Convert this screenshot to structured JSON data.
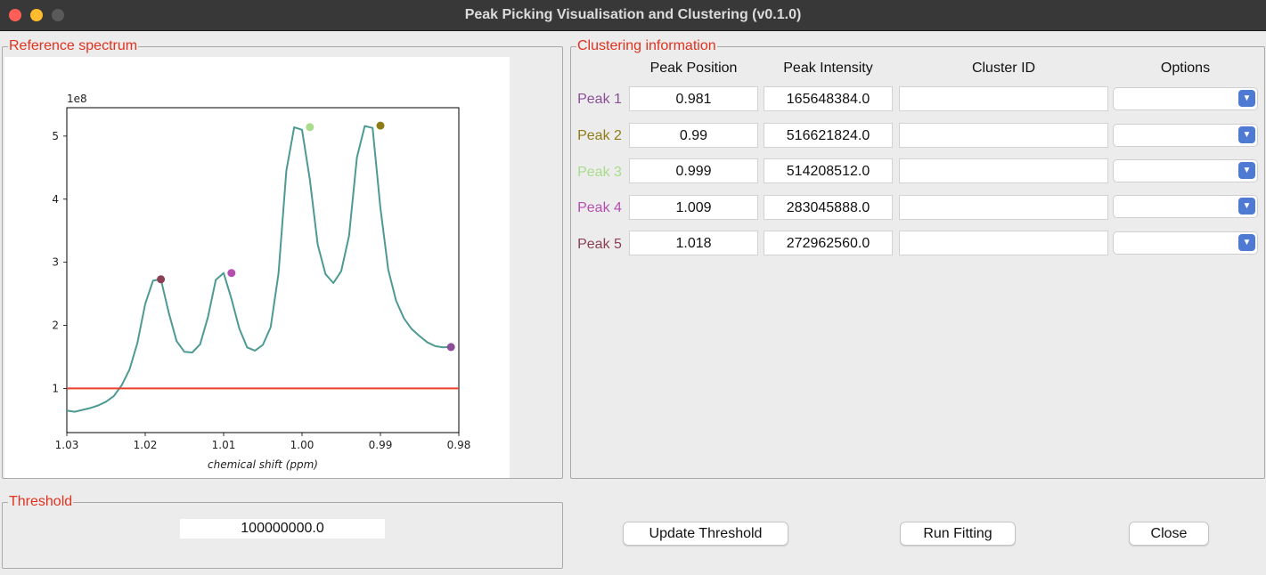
{
  "window": {
    "title": "Peak Picking Visualisation and Clustering (v0.1.0)"
  },
  "reference_panel": {
    "title": "Reference spectrum"
  },
  "clustering_panel": {
    "title": "Clustering information",
    "headers": {
      "position": "Peak Position",
      "intensity": "Peak Intensity",
      "cluster_id": "Cluster ID",
      "options": "Options"
    },
    "rows": [
      {
        "label": "Peak 1",
        "color": "#8a4f96",
        "position": "0.981",
        "intensity": "165648384.0",
        "cluster_id": ""
      },
      {
        "label": "Peak 2",
        "color": "#8e7c16",
        "position": "0.99",
        "intensity": "516621824.0",
        "cluster_id": ""
      },
      {
        "label": "Peak 3",
        "color": "#a9dc8c",
        "position": "0.999",
        "intensity": "514208512.0",
        "cluster_id": ""
      },
      {
        "label": "Peak 4",
        "color": "#b44fb0",
        "position": "1.009",
        "intensity": "283045888.0",
        "cluster_id": ""
      },
      {
        "label": "Peak 5",
        "color": "#8b3f55",
        "position": "1.018",
        "intensity": "272962560.0",
        "cluster_id": ""
      }
    ]
  },
  "threshold_panel": {
    "title": "Threshold",
    "value": "100000000.0"
  },
  "buttons": {
    "update_threshold": "Update Threshold",
    "run_fitting": "Run Fitting",
    "close": "Close"
  },
  "chart_data": {
    "type": "line",
    "xlabel": "chemical shift (ppm)",
    "ylabel": "",
    "y_offset_label": "1e8",
    "xlim": [
      1.03,
      0.98
    ],
    "ylim": [
      0.3,
      5.45
    ],
    "x_reversed": true,
    "x_ticks": [
      1.03,
      1.02,
      1.01,
      1.0,
      0.99,
      0.98
    ],
    "x_tick_labels": [
      "1.03",
      "1.02",
      "1.01",
      "1.00",
      "0.99",
      "0.98"
    ],
    "y_ticks": [
      1,
      2,
      3,
      4,
      5
    ],
    "y_tick_labels": [
      "1",
      "2",
      "3",
      "4",
      "5"
    ],
    "line_color": "#4d9a93",
    "series": [
      {
        "x": [
          1.03,
          1.029,
          1.028,
          1.027,
          1.026,
          1.025,
          1.024,
          1.023,
          1.022,
          1.021,
          1.02,
          1.019,
          1.018,
          1.017,
          1.016,
          1.015,
          1.014,
          1.013,
          1.012,
          1.011,
          1.01,
          1.009,
          1.008,
          1.007,
          1.006,
          1.005,
          1.004,
          1.003,
          1.002,
          1.001,
          1.0,
          0.999,
          0.998,
          0.997,
          0.996,
          0.995,
          0.994,
          0.993,
          0.992,
          0.991,
          0.99,
          0.989,
          0.988,
          0.987,
          0.986,
          0.985,
          0.984,
          0.983,
          0.982,
          0.981
        ],
        "y": [
          0.65,
          0.63,
          0.66,
          0.69,
          0.73,
          0.79,
          0.88,
          1.05,
          1.3,
          1.72,
          2.34,
          2.71,
          2.73,
          2.2,
          1.75,
          1.58,
          1.57,
          1.7,
          2.13,
          2.72,
          2.83,
          2.42,
          1.95,
          1.65,
          1.6,
          1.69,
          1.97,
          2.82,
          4.45,
          5.14,
          5.1,
          4.31,
          3.28,
          2.81,
          2.67,
          2.86,
          3.42,
          4.66,
          5.16,
          5.13,
          3.86,
          2.88,
          2.39,
          2.11,
          1.94,
          1.83,
          1.73,
          1.67,
          1.65,
          1.66
        ]
      }
    ],
    "threshold": {
      "value": 1.0,
      "color": "#e8402b"
    },
    "peak_markers": [
      {
        "x": 0.981,
        "y": 1.656,
        "color": "#8a4f96"
      },
      {
        "x": 0.99,
        "y": 5.166,
        "color": "#8e7c16"
      },
      {
        "x": 0.999,
        "y": 5.142,
        "color": "#a9dc8c"
      },
      {
        "x": 1.009,
        "y": 2.83,
        "color": "#b44fb0"
      },
      {
        "x": 1.018,
        "y": 2.73,
        "color": "#8b3f55"
      }
    ]
  }
}
